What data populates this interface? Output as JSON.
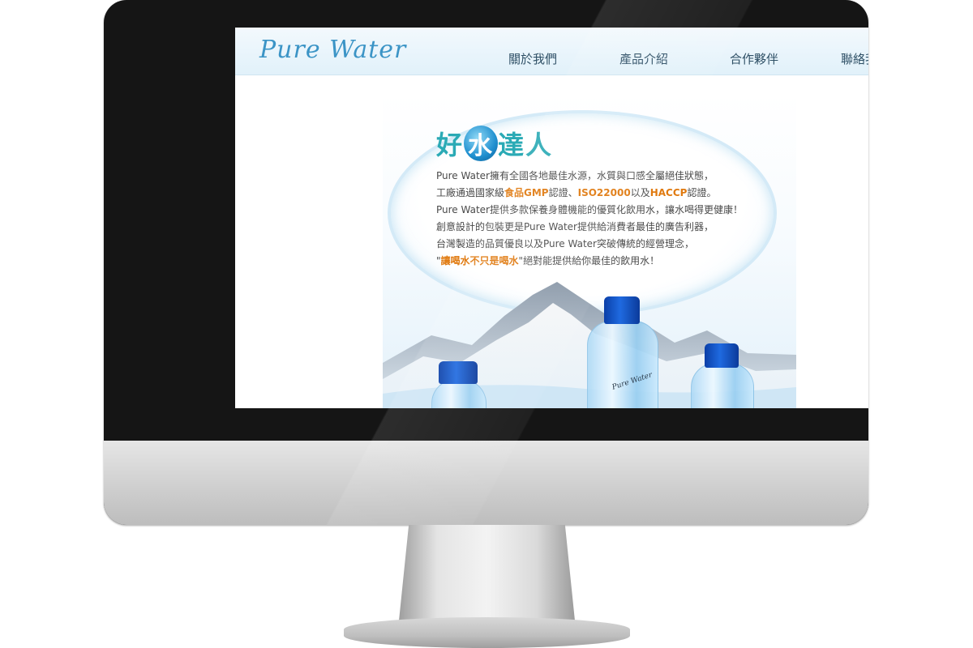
{
  "site": {
    "logo": "Pure Water",
    "nav": [
      "關於我們",
      "產品介紹",
      "合作夥伴",
      "聯絡我們"
    ]
  },
  "banner": {
    "title_pre": "好",
    "title_accent": "水",
    "title_post": "達人",
    "lines": [
      [
        {
          "t": "Pure Water擁有全國各地最佳水源，水質與口感全屬絕佳狀態，",
          "hl": false
        }
      ],
      [
        {
          "t": "工廠通過國家級",
          "hl": false
        },
        {
          "t": "食品GMP",
          "hl": true
        },
        {
          "t": "認證、",
          "hl": false
        },
        {
          "t": "ISO22000",
          "hl": true
        },
        {
          "t": "以及",
          "hl": false
        },
        {
          "t": "HACCP",
          "hl": true
        },
        {
          "t": "認證。",
          "hl": false
        }
      ],
      [
        {
          "t": "Pure Water提供多款保養身體機能的優質化飲用水，讓水喝得更健康！",
          "hl": false
        }
      ],
      [
        {
          "t": "創意設計的包裝更是Pure Water提供給消費者最佳的廣告利器，",
          "hl": false
        }
      ],
      [
        {
          "t": "台灣製造的品質優良以及Pure Water突破傳統的經營理念，",
          "hl": false
        }
      ],
      [
        {
          "t": "\"",
          "hl": false
        },
        {
          "t": "讓喝水不只是喝水",
          "hl": true
        },
        {
          "t": "\"絕對能提供給你最佳的飲用水！",
          "hl": false
        }
      ]
    ],
    "bottle_label": "Pure Water"
  },
  "colors": {
    "logo": "#3b94c6",
    "title": "#2aaab5",
    "highlight": "#e07a10",
    "cap": "#1f6ae0"
  }
}
